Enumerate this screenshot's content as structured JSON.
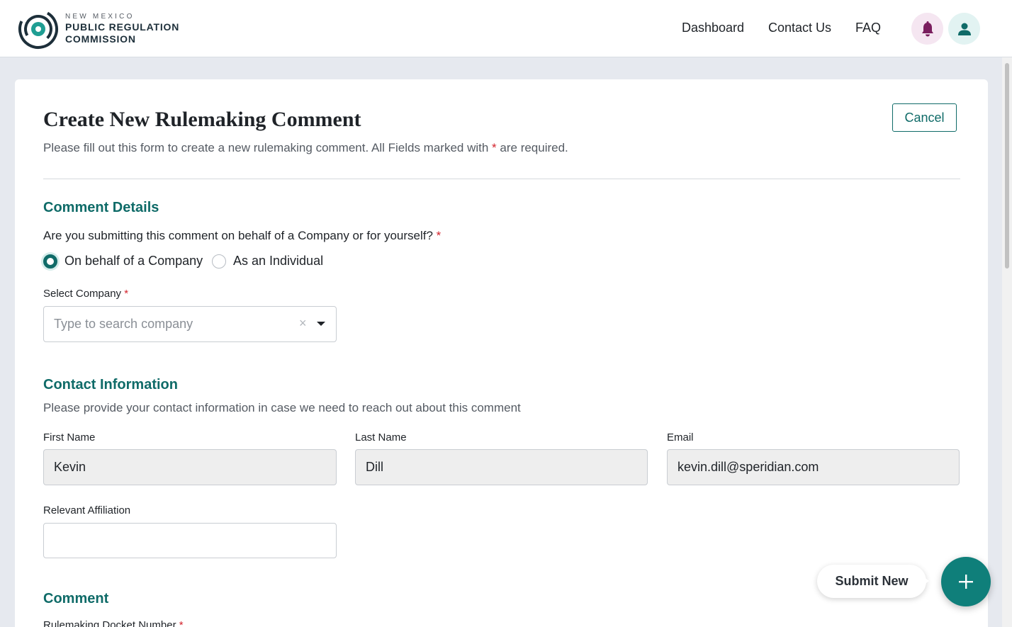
{
  "brand": {
    "line1": "NEW MEXICO",
    "line2": "PUBLIC REGULATION",
    "line3": "COMMISSION"
  },
  "nav": {
    "dashboard": "Dashboard",
    "contact": "Contact Us",
    "faq": "FAQ"
  },
  "header": {
    "title": "Create New Rulemaking Comment",
    "subtitle_before": "Please fill out this form to create a new rulemaking comment. All Fields marked with ",
    "required_mark": "*",
    "subtitle_after": " are required.",
    "cancel_label": "Cancel"
  },
  "comment_details": {
    "section_title": "Comment Details",
    "question": "Are you submitting this comment on behalf of a Company or for yourself?",
    "options": [
      {
        "label": "On behalf of a Company",
        "selected": true
      },
      {
        "label": "As an Individual",
        "selected": false
      }
    ],
    "company_label": "Select Company",
    "company_placeholder": "Type to search company",
    "clear_glyph": "×"
  },
  "contact": {
    "section_title": "Contact Information",
    "help": "Please provide your contact information in case we need to reach out about this comment",
    "first_name_label": "First Name",
    "first_name_value": "Kevin",
    "last_name_label": "Last Name",
    "last_name_value": "Dill",
    "email_label": "Email",
    "email_value": "kevin.dill@speridian.com",
    "affiliation_label": "Relevant Affiliation",
    "affiliation_value": ""
  },
  "comment": {
    "section_title": "Comment",
    "docket_label": "Rulemaking Docket Number"
  },
  "fab": {
    "submit_label": "Submit New"
  },
  "colors": {
    "accent": "#0f6b68",
    "required": "#d3232c",
    "bell_bg": "#f5e6f1",
    "bell_icon": "#7a1e5e",
    "user_bg": "#e2f3f2"
  }
}
